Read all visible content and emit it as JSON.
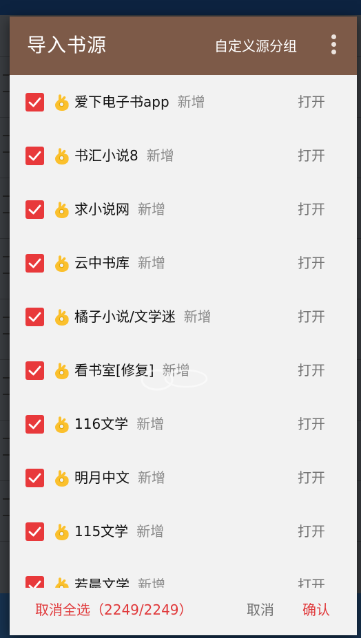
{
  "dialog": {
    "title": "导入书源",
    "group_button": "自定义源分组",
    "more_icon": "more-vert-icon"
  },
  "accent_color": "#e8393b",
  "header_color": "#7d5a48",
  "items": [
    {
      "name": "爱下电子书app",
      "status": "新增",
      "action": "打开",
      "checked": true
    },
    {
      "name": "书汇小说8",
      "status": "新增",
      "action": "打开",
      "checked": true
    },
    {
      "name": "求小说网",
      "status": "新增",
      "action": "打开",
      "checked": true
    },
    {
      "name": "云中书库",
      "status": "新增",
      "action": "打开",
      "checked": true
    },
    {
      "name": "橘子小说/文学迷",
      "status": "新增",
      "action": "打开",
      "checked": true
    },
    {
      "name": "看书室[修复]",
      "status": "新增",
      "action": "打开",
      "checked": true
    },
    {
      "name": "116文学",
      "status": "新增",
      "action": "打开",
      "checked": true
    },
    {
      "name": "明月中文",
      "status": "新增",
      "action": "打开",
      "checked": true
    },
    {
      "name": "115文学",
      "status": "新增",
      "action": "打开",
      "checked": true
    },
    {
      "name": "若晨文学",
      "status": "新增",
      "action": "打开",
      "checked": true
    }
  ],
  "footer": {
    "select_all": "取消全选（2249/2249）",
    "cancel": "取消",
    "confirm": "确认"
  }
}
